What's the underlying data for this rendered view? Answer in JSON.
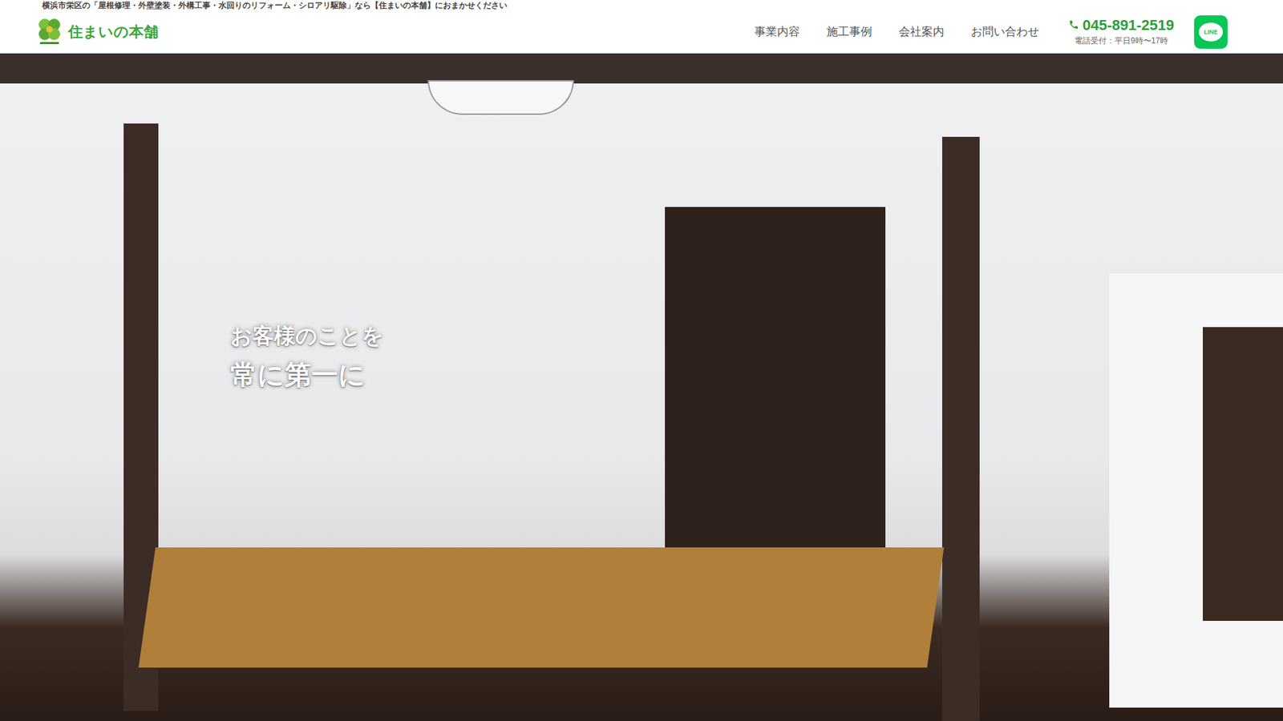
{
  "header": {
    "tagline": "横浜市栄区の「屋根修理・外壁塗装・外構工事・水回りのリフォーム・シロアリ駆除」なら【住まいの本舗】におまかせください",
    "logo_text": "住まいの本舗",
    "nav": [
      "事業内容",
      "施工事例",
      "会社案内",
      "お問い合わせ"
    ],
    "phone": "045-891-2519",
    "phone_hours": "電話受付：平日9時〜17時",
    "line_label": "LINE"
  },
  "hero": {
    "lines": [
      "お客様のことを",
      "常に第一に"
    ]
  }
}
